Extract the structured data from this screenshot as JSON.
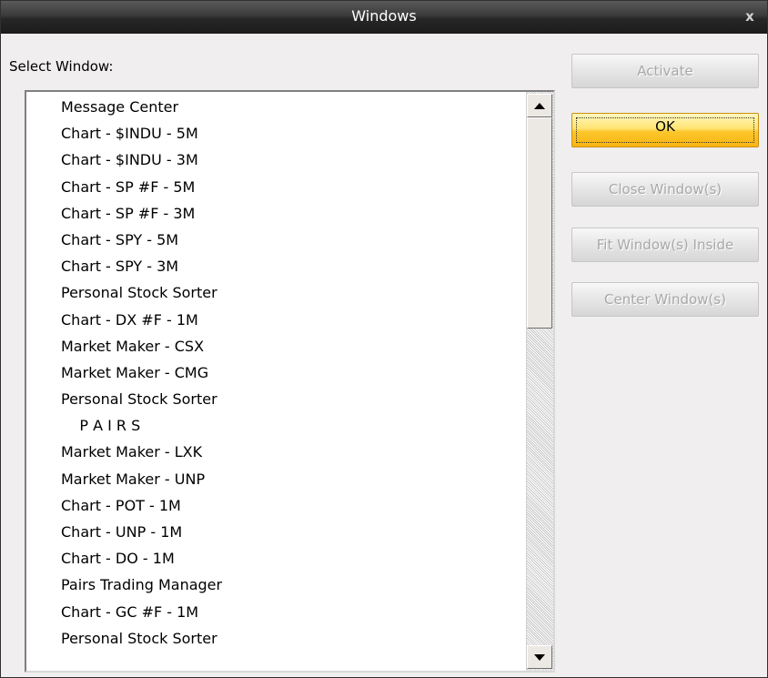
{
  "window": {
    "title": "Windows",
    "close_glyph": "x"
  },
  "select_label": "Select Window:",
  "list": {
    "items": [
      "Message Center",
      "Chart - $INDU - 5M",
      "Chart - $INDU - 3M",
      "Chart - SP #F - 5M",
      "Chart - SP #F - 3M",
      "Chart - SPY - 5M",
      "Chart - SPY - 3M",
      "Personal Stock Sorter",
      "Chart - DX #F - 1M",
      "Market Maker - CSX",
      "Market Maker - CMG",
      "Personal Stock Sorter",
      "    P A I R S",
      "Market Maker - LXK",
      "Market Maker - UNP",
      "Chart - POT - 1M",
      "Chart - UNP - 1M",
      "Chart - DO - 1M",
      "Pairs Trading Manager",
      "Chart - GC #F - 1M",
      "Personal Stock Sorter"
    ]
  },
  "buttons": {
    "activate": "Activate",
    "ok": "OK",
    "close_windows": "Close Window(s)",
    "fit_windows_inside": "Fit Window(s) Inside",
    "center_windows": "Center Window(s)"
  },
  "icons": {
    "close": "close-icon",
    "scroll_up": "scroll-up-arrow-icon",
    "scroll_down": "scroll-down-arrow-icon"
  },
  "colors": {
    "titlebar": "#262626",
    "dialog_bg": "#f0eeee",
    "ok_button": "#fcc62c",
    "disabled_text": "#a8a8a8"
  }
}
